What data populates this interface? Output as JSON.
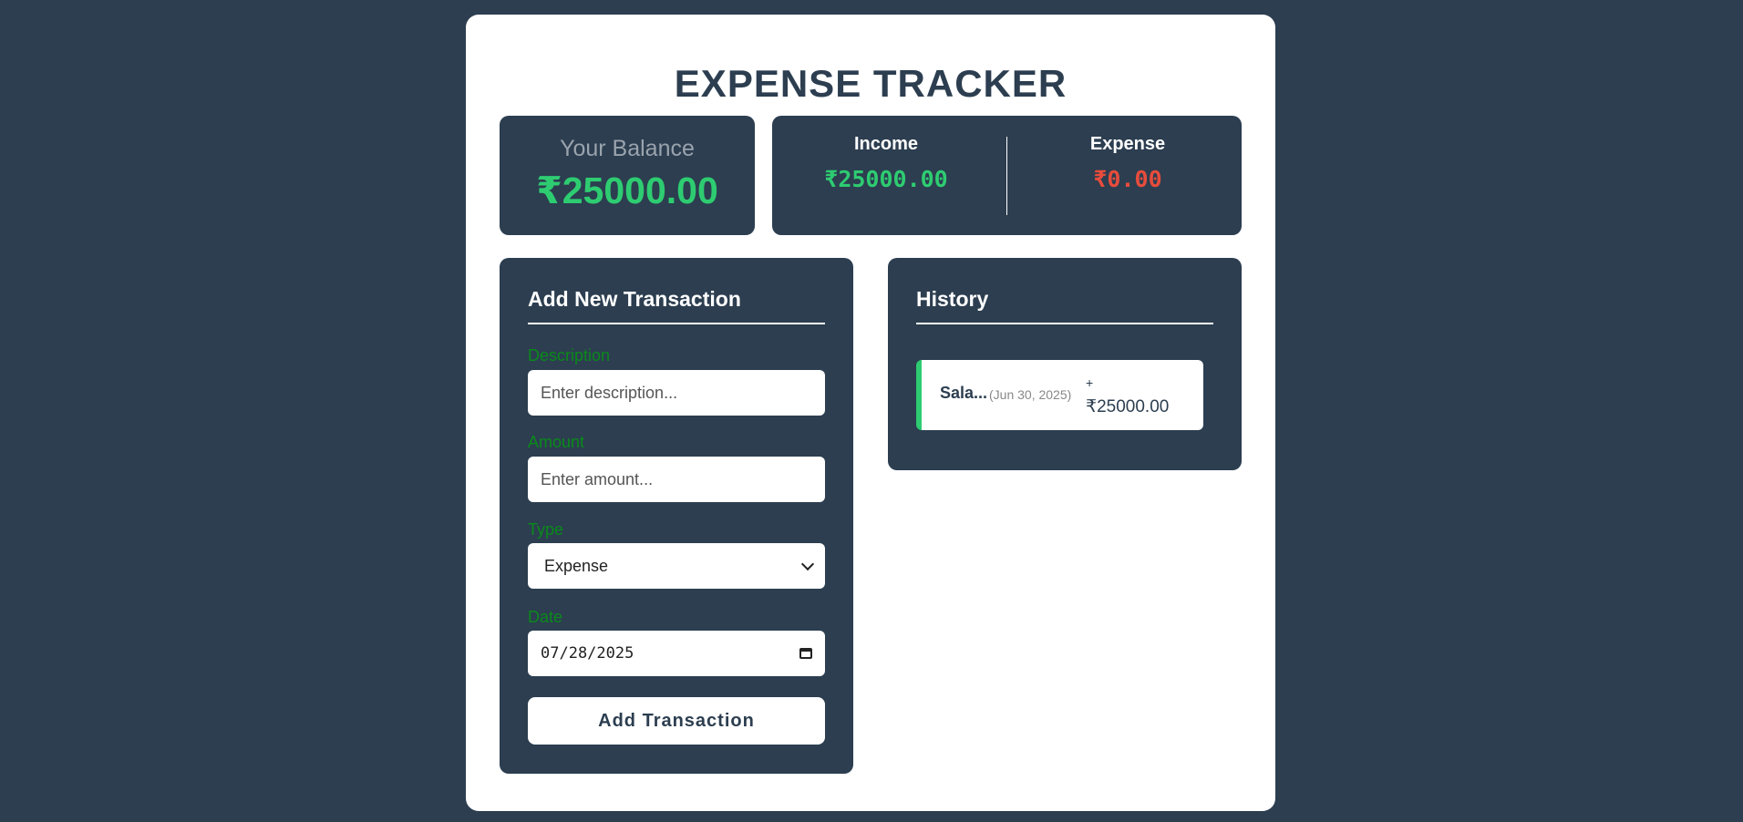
{
  "app": {
    "title": "EXPENSE TRACKER"
  },
  "balance": {
    "label": "Your Balance",
    "value": "₹25000.00"
  },
  "summary": {
    "income_label": "Income",
    "income_value": "₹25000.00",
    "expense_label": "Expense",
    "expense_value": "₹0.00"
  },
  "form": {
    "title": "Add New Transaction",
    "description": {
      "label": "Description",
      "placeholder": "Enter description..."
    },
    "amount": {
      "label": "Amount",
      "placeholder": "Enter amount..."
    },
    "type": {
      "label": "Type",
      "selected": "Expense"
    },
    "date": {
      "label": "Date",
      "value": "07/28/2025"
    },
    "submit_label": "Add Transaction"
  },
  "history": {
    "title": "History",
    "items": [
      {
        "description": "Sala...",
        "date": "(Jun 30, 2025)",
        "sign": "+",
        "amount": "₹25000.00",
        "type_color": "#2ecc71"
      }
    ]
  },
  "colors": {
    "background": "#2c3e50",
    "income": "#2ecc71",
    "expense": "#e74c3c",
    "label": "#0a8a1a"
  }
}
